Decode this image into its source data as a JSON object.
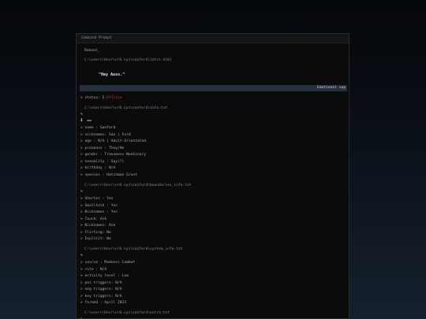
{
  "window": {
    "title": "Command Prompt"
  },
  "intro": {
    "command": "Reboot_",
    "path": "C:\\users\\User\\vr8.sys\\sanford\\intro.html",
    "greeting": "\"Hey Auss.\""
  },
  "status_bar": {
    "label": "Emotional sup"
  },
  "status": {
    "label": "> status: ",
    "value": "Offline",
    "value_prefix": "E-"
  },
  "info": {
    "path": "C:\\users\\User\\vr8.sys\\sanford\\info.txt",
    "cursor": "%",
    "marker": "I  ==",
    "lines": [
      "> name : Sanford",
      "> nicknames: San | Ford",
      "> age : N/A | Adult-Orientated",
      "> pronouns : They/He",
      "> gender : Transmasc Nonbinary",
      "> sexuality : Gay(?)",
      "> birthday : N/A",
      "> species : Hatchman Grunt"
    ]
  },
  "boundaries": {
    "path": "C:\\users\\User\\vr8.sys\\sanford\\boundaries_info.txt",
    "cursor": "%",
    "lines": [
      "> Shorter : Yes",
      "> Smalltalk : Yes",
      "> Nicknames : Yes",
      "> Touch: Ask",
      "> Nicknames: Ask",
      "> Flirting: No",
      "> Explicit: No"
    ]
  },
  "system": {
    "path": "C:\\users\\User\\vr8.sys\\sanford\\system_info.txt",
    "cursor": "%",
    "lines": [
      "> source : Madness Combat",
      "> role : N/A",
      "> activity level : Low",
      "> pos triggers: N/A",
      "> neg triggers: N/A",
      "> key triggers: N/A",
      "> formed : April 2023"
    ]
  },
  "extra": {
    "path": "C:\\users\\User\\vr8.sys\\sanford\\extra.txt",
    "cursor": "%"
  }
}
